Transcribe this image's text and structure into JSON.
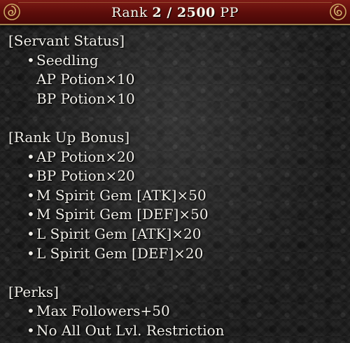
{
  "header": {
    "rank_label": "Rank",
    "rank_value": "2 / 2500",
    "pp_label": "PP"
  },
  "bullet_char": "•",
  "sections": {
    "servant_status": {
      "title": "[Servant Status]",
      "items": [
        "Seedling"
      ],
      "sub_items": [
        "AP Potion×10",
        "BP Potion×10"
      ]
    },
    "rank_up_bonus": {
      "title": "[Rank Up Bonus]",
      "items": [
        "AP Potion×20",
        "BP Potion×20",
        "M Spirit Gem [ATK]×50",
        "M Spirit Gem [DEF]×50",
        "L Spirit Gem [ATK]×20",
        "L Spirit Gem [DEF]×20"
      ]
    },
    "perks": {
      "title": "[Perks]",
      "items": [
        "Max Followers+50",
        "No All Out Lvl. Restriction"
      ]
    }
  },
  "colors": {
    "banner_red": "#5c0d0a",
    "banner_trim": "#a3844f",
    "text": "#f2f0ea",
    "background": "#1b1b1b"
  },
  "icons": {
    "left_ornament": "scroll-ornament-icon",
    "right_ornament": "scroll-ornament-icon"
  }
}
